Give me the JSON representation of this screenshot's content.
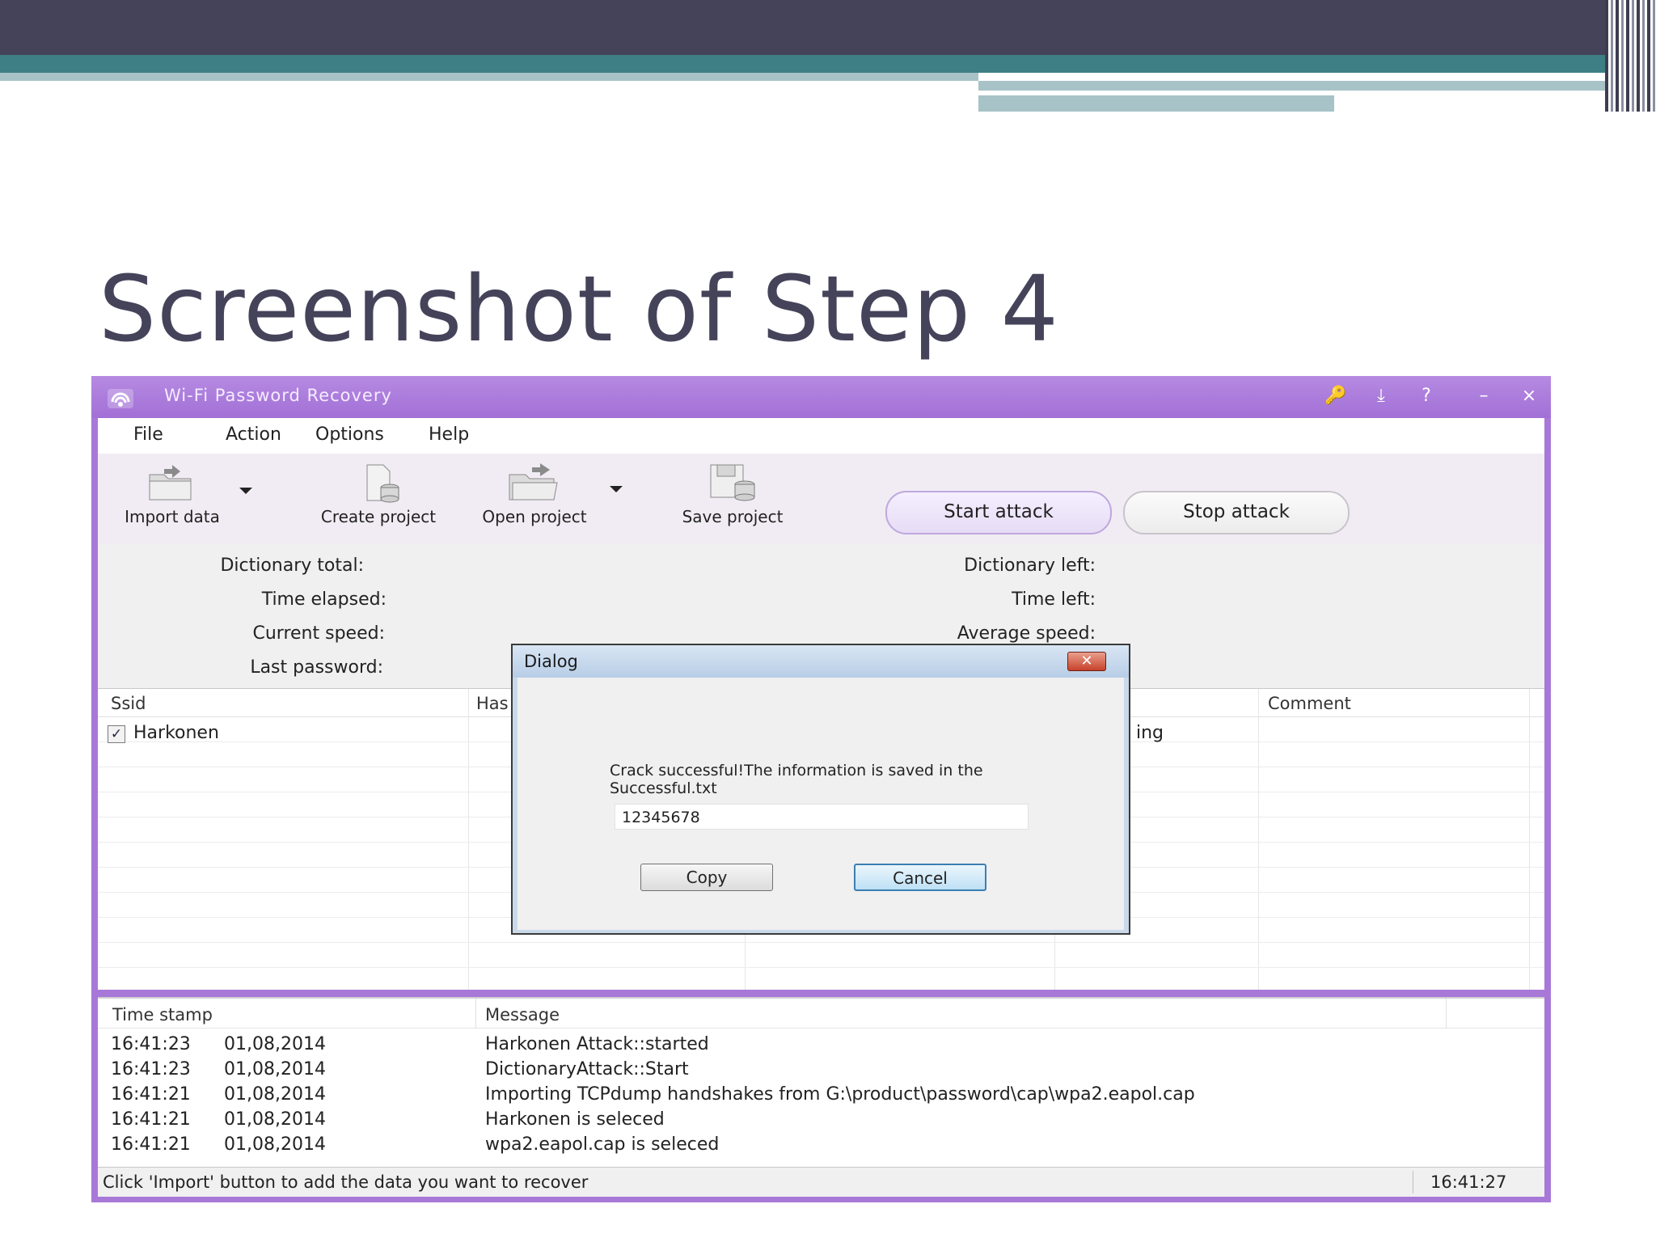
{
  "slide": {
    "title": "Screenshot of Step 4"
  },
  "window": {
    "title": "Wi-Fi Password Recovery",
    "controls": {
      "key_icon": "🔑",
      "download_icon": "⤓",
      "help": "?",
      "minimize": "–",
      "close": "×"
    }
  },
  "menu": [
    "File",
    "Action",
    "Options",
    "Help"
  ],
  "toolbar": {
    "import_data": "Import data",
    "create_project": "Create project",
    "open_project": "Open project",
    "save_project": "Save project",
    "start_attack": "Start attack",
    "stop_attack": "Stop attack"
  },
  "stats": {
    "dictionary_total": "Dictionary total:",
    "time_elapsed": "Time elapsed:",
    "current_speed": "Current speed:",
    "last_password": "Last password:",
    "dictionary_left": "Dictionary left:",
    "time_left": "Time left:",
    "average_speed": "Average speed:"
  },
  "grid": {
    "columns": {
      "ssid": "Ssid",
      "hash": "Has",
      "comment": "Comment"
    },
    "rows": [
      {
        "checked": true,
        "check_glyph": "✓",
        "ssid": "Harkonen",
        "status_fragment": "ing"
      }
    ]
  },
  "log": {
    "columns": {
      "time_stamp": "Time stamp",
      "message": "Message"
    },
    "rows": [
      {
        "time": "16:41:23",
        "date": "01,08,2014",
        "message": "Harkonen Attack::started"
      },
      {
        "time": "16:41:23",
        "date": "01,08,2014",
        "message": "DictionaryAttack::Start"
      },
      {
        "time": "16:41:21",
        "date": "01,08,2014",
        "message": "Importing TCPdump handshakes from G:\\product\\password\\cap\\wpa2.eapol.cap"
      },
      {
        "time": "16:41:21",
        "date": "01,08,2014",
        "message": "Harkonen is seleced"
      },
      {
        "time": "16:41:21",
        "date": "01,08,2014",
        "message": "wpa2.eapol.cap is seleced"
      }
    ]
  },
  "statusbar": {
    "hint": "Click 'Import' button to add the data you want to recover",
    "time": "16:41:27"
  },
  "dialog": {
    "title": "Dialog",
    "close_glyph": "✕",
    "message_line1": "Crack successful!The information is saved in the",
    "message_line2": "Successful.txt",
    "password": "12345678",
    "copy": "Copy",
    "cancel": "Cancel"
  }
}
